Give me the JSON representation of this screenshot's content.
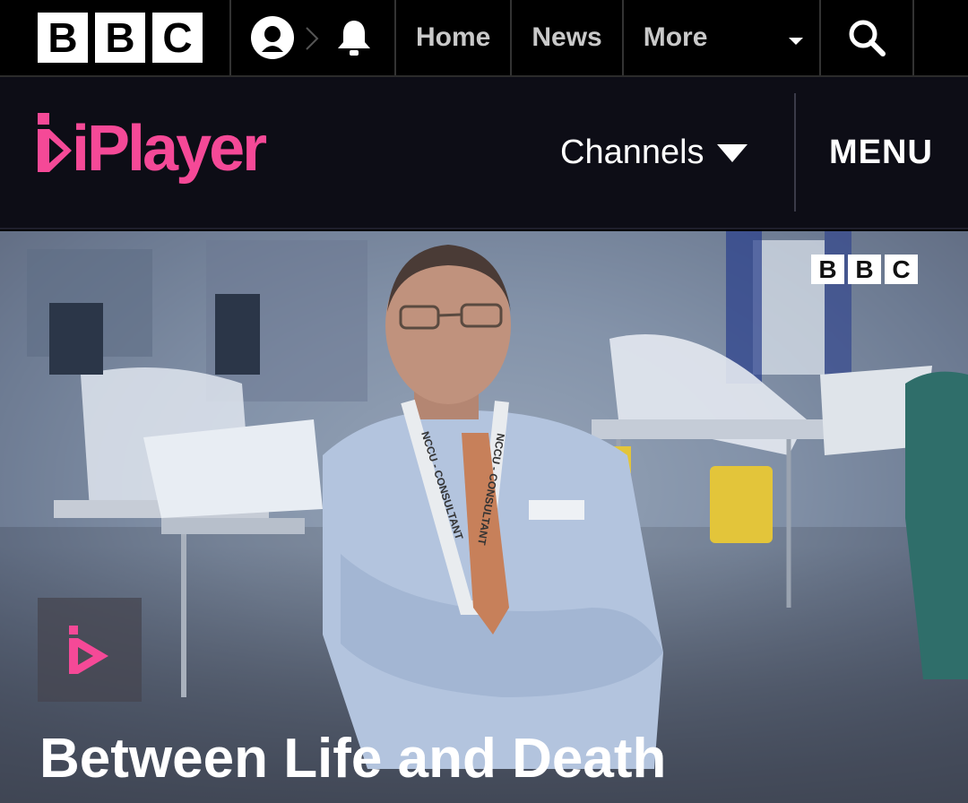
{
  "bbc_nav": {
    "logo_letters": [
      "B",
      "B",
      "C"
    ],
    "account_icon": "account-icon",
    "notifications_icon": "bell-icon",
    "links": [
      {
        "label": "Home"
      },
      {
        "label": "News"
      },
      {
        "label": "More"
      }
    ],
    "more_icon": "chevron-down-icon",
    "search_icon": "search-icon"
  },
  "iplayer_header": {
    "logo_text": "iPlayer",
    "channels_label": "Channels",
    "channels_icon": "caret-down-icon",
    "menu_label": "MENU",
    "brand_color": "#f54997"
  },
  "hero": {
    "channel_logo_letters": [
      "B",
      "B",
      "C"
    ],
    "lanyard_text": "NCCU - CONSULTANT",
    "play_icon": "iplayer-play-icon",
    "title": "Between Life and Death"
  }
}
